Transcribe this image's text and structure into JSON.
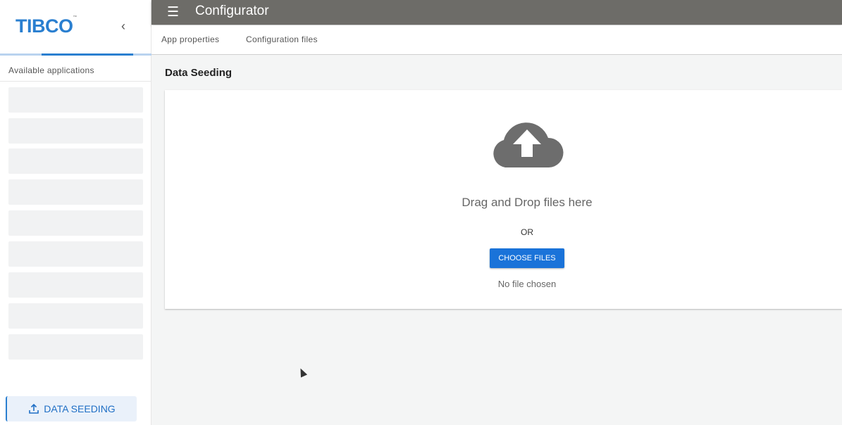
{
  "sidebar": {
    "logo": "TIBCO",
    "available_label": "Available applications",
    "data_seeding_button": "DATA SEEDING"
  },
  "topbar": {
    "title": "Configurator"
  },
  "tabs": [
    {
      "label": "App properties"
    },
    {
      "label": "Configuration files"
    }
  ],
  "main": {
    "heading": "Data Seeding",
    "drag_text": "Drag and Drop files here",
    "or_text": "OR",
    "choose_button": "CHOOSE FILES",
    "file_status": "No file chosen"
  },
  "colors": {
    "accent": "#1a73d9",
    "topbar": "#6d6c68"
  }
}
